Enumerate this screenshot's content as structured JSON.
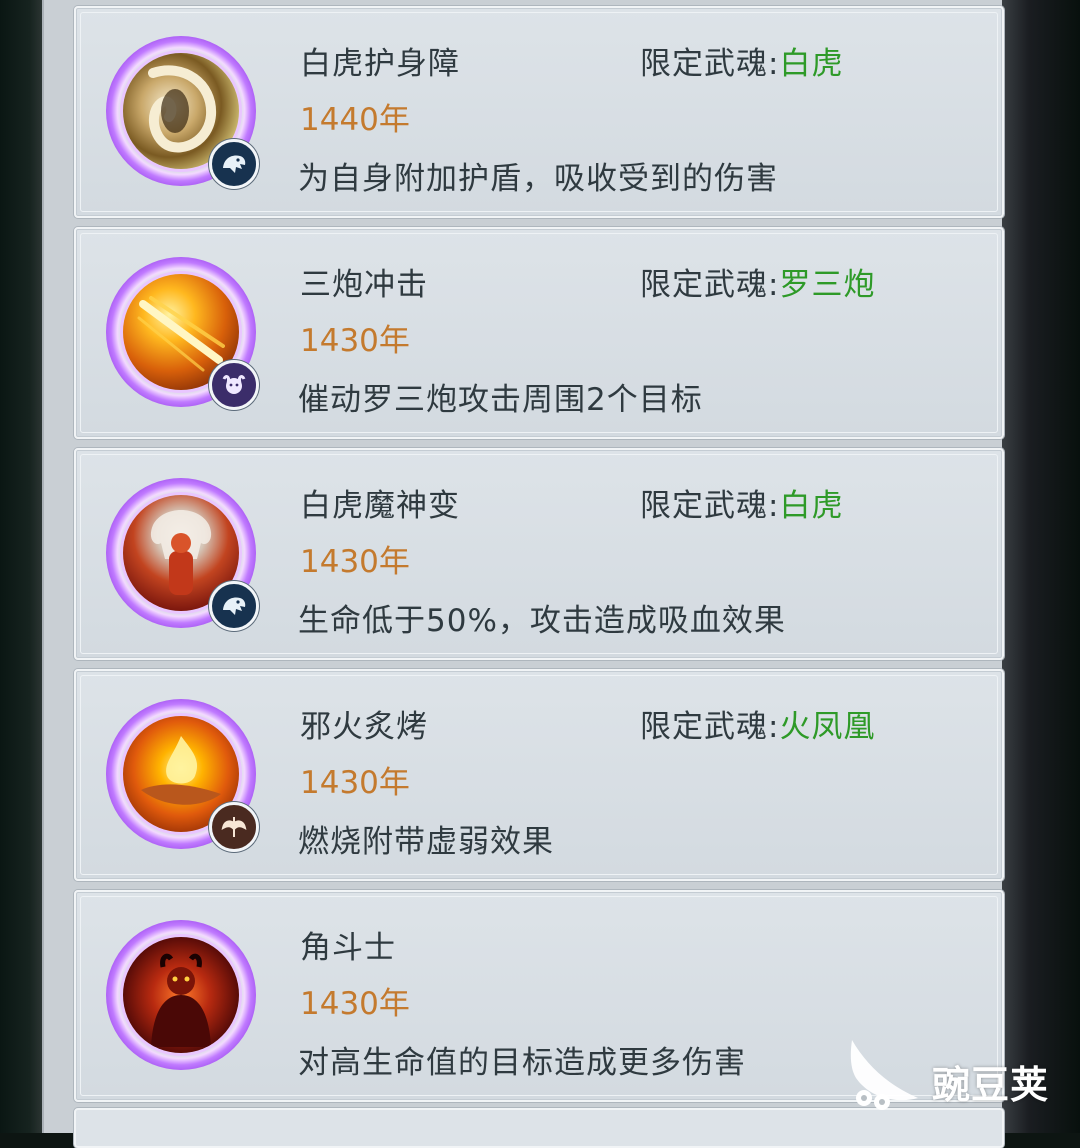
{
  "skills": [
    {
      "name": "白虎护身障",
      "restrict_label": "限定武魂:",
      "soul": "白虎",
      "year": "1440年",
      "desc": "为自身附加护盾，吸收受到的伤害",
      "icon": "tiger-shield-icon",
      "badge": "white-tiger-badge-icon"
    },
    {
      "name": "三炮冲击",
      "restrict_label": "限定武魂:",
      "soul": "罗三炮",
      "year": "1430年",
      "desc": "催动罗三炮攻击周围2个目标",
      "icon": "cannon-strike-icon",
      "badge": "luo-sanpao-badge-icon"
    },
    {
      "name": "白虎魔神变",
      "restrict_label": "限定武魂:",
      "soul": "白虎",
      "year": "1430年",
      "desc": "生命低于50%，攻击造成吸血效果",
      "icon": "tiger-demon-icon",
      "badge": "white-tiger-badge-icon"
    },
    {
      "name": "邪火炙烤",
      "restrict_label": "限定武魂:",
      "soul": "火凤凰",
      "year": "1430年",
      "desc": "燃烧附带虚弱效果",
      "icon": "evil-fire-icon",
      "badge": "phoenix-badge-icon"
    },
    {
      "name": "角斗士",
      "restrict_label": "",
      "soul": "",
      "year": "1430年",
      "desc": "对高生命值的目标造成更多伤害",
      "icon": "gladiator-icon",
      "badge": ""
    }
  ],
  "watermark": {
    "text": "豌豆荚"
  },
  "colors": {
    "soul": "#2e9a28",
    "year": "#c47a2e",
    "ring": "#a95cf3",
    "panel": "#c9cfd4"
  }
}
